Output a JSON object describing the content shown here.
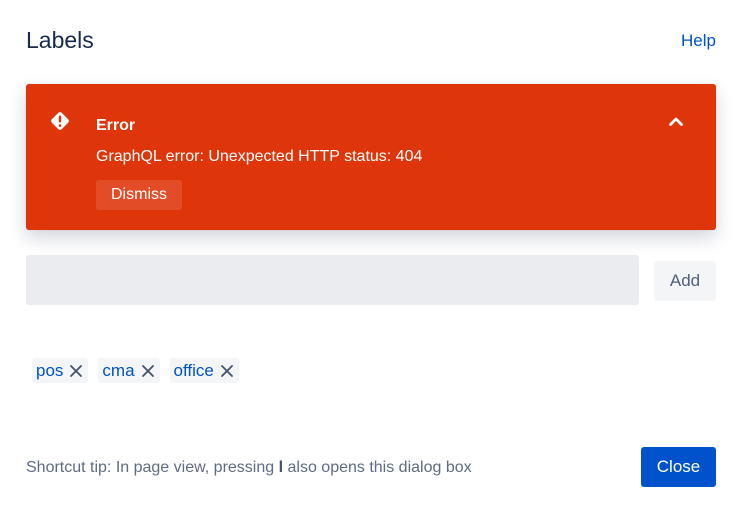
{
  "dialog": {
    "title": "Labels",
    "help_label": "Help"
  },
  "error": {
    "icon": "error-diamond-icon",
    "title": "Error",
    "message": "GraphQL error: Unexpected HTTP status: 404",
    "dismiss_label": "Dismiss",
    "collapse_icon": "chevron-up-icon",
    "color": "#de350b"
  },
  "input": {
    "value": "",
    "placeholder": "",
    "add_label": "Add"
  },
  "labels": [
    {
      "text": "pos"
    },
    {
      "text": "cma"
    },
    {
      "text": "office"
    }
  ],
  "footer": {
    "tip_prefix": "Shortcut tip: In page view, pressing",
    "tip_key": "l",
    "tip_suffix": "also opens this dialog box",
    "close_label": "Close"
  },
  "colors": {
    "link": "#0052cc",
    "primary_button": "#0052cc",
    "input_background": "#ebecf0"
  }
}
